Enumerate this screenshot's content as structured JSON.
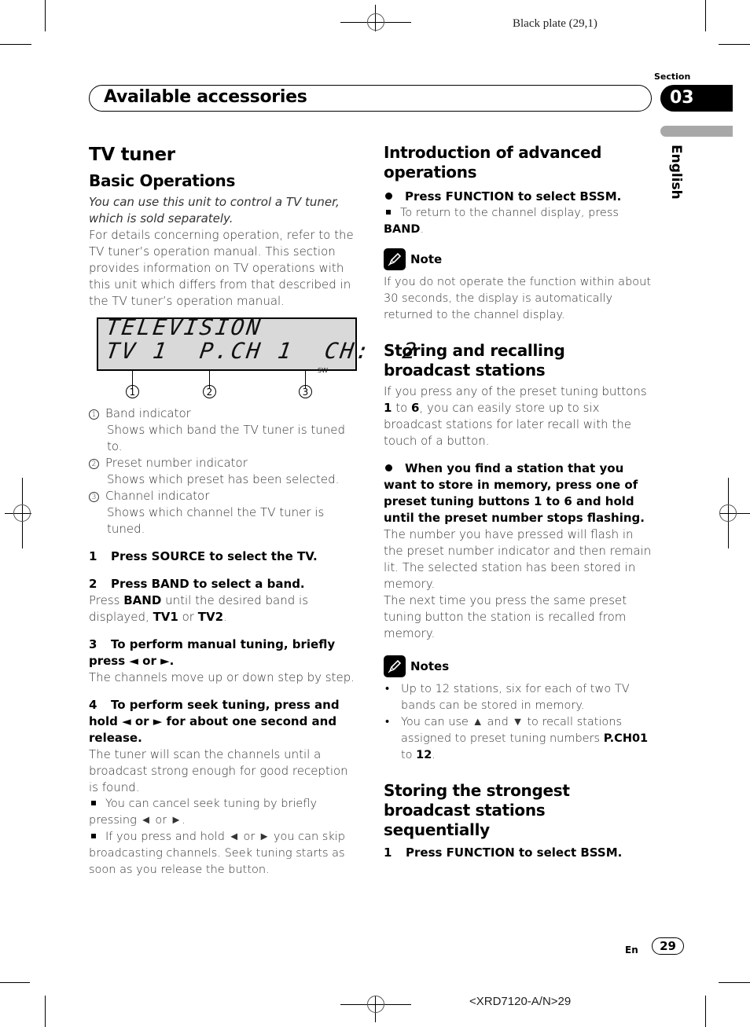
{
  "print_marks": {
    "plate_label": "Black plate (29,1)",
    "job_code": "<XRD7120-A/N>29"
  },
  "header": {
    "banner_title": "Available accessories",
    "section_label": "Section",
    "section_number": "03",
    "language": "English"
  },
  "left": {
    "title": "TV tuner",
    "subtitle": "Basic Operations",
    "intro_italic": "You can use this unit to control a TV tuner, which is sold separately.",
    "intro": "For details concerning operation, refer to the TV tuner’s operation manual. This section provides information on TV operations with this unit which differs from that described in the TV tuner’s operation manual.",
    "lcd": {
      "line1": "TELEVISION",
      "band": "TV 1",
      "preset": "P.CH 1",
      "channel": "CH:  2",
      "sw": "SW",
      "callouts": [
        "1",
        "2",
        "3"
      ]
    },
    "indicators": [
      {
        "num": "1",
        "name": "Band indicator",
        "desc": "Shows which band the TV tuner is tuned to."
      },
      {
        "num": "2",
        "name": "Preset number indicator",
        "desc": "Shows which preset has been selected."
      },
      {
        "num": "3",
        "name": "Channel indicator",
        "desc": "Shows which channel the TV tuner is tuned."
      }
    ],
    "steps": [
      {
        "num": "1",
        "text": "Press SOURCE to select the TV."
      },
      {
        "num": "2",
        "text": "Press BAND to select a band."
      },
      {
        "num": "3",
        "text": "To perform manual tuning, briefly press ◄ or ►."
      },
      {
        "num": "4",
        "text": "To perform seek tuning, press and hold ◄ or ► for about one second and release."
      }
    ],
    "step2_body": {
      "pre": "Press ",
      "b1": "BAND",
      "mid": " until the desired band is displayed, ",
      "b2": "TV1",
      "or": " or ",
      "b3": "TV2",
      "end": "."
    },
    "step3_body": "The channels move up or down step by step.",
    "step4_body": "The tuner will scan the channels until a broadcast strong enough for good reception is found.",
    "step4_bullets": [
      "You can cancel seek tuning by briefly pressing ◄ or ►.",
      "If you press and hold ◄ or ► you can skip broadcasting channels. Seek tuning starts as soon as you release the button."
    ]
  },
  "right": {
    "adv_title": "Introduction of advanced operations",
    "adv_step": "Press FUNCTION to select BSSM.",
    "adv_bullet": {
      "pre": "To return to the channel display, press ",
      "b": "BAND",
      "end": "."
    },
    "note_label": "Note",
    "note_text": "If you do not operate the function within about 30 seconds, the display is automatically returned to the channel display.",
    "store_title": "Storing and recalling broadcast stations",
    "store_body": {
      "pre": "If you press any of the preset tuning buttons ",
      "b1": "1",
      "mid": " to ",
      "b2": "6",
      "end": ", you can easily store up to six broadcast stations for later recall with the touch of a button."
    },
    "store_step": "When you find a station that you want to store in memory, press one of preset tuning buttons 1 to 6 and hold until the preset number stops flashing.",
    "store_p1": "The number you have pressed will flash in the preset number indicator and then remain lit. The selected station has been stored in memory.",
    "store_p2": "The next time you press the same preset tuning button the station is recalled from memory.",
    "notes_label": "Notes",
    "notes": [
      {
        "text": "Up to 12 stations, six for each of two TV bands can be stored in memory."
      },
      {
        "pre": "You can use ▲ and ▼ to recall stations assigned to preset tuning numbers ",
        "b1": "P.CH01",
        "mid": " to ",
        "b2": "12",
        "end": "."
      }
    ],
    "bssm_title": "Storing the strongest broadcast stations sequentially",
    "bssm_step": {
      "num": "1",
      "text": "Press FUNCTION to select BSSM."
    }
  },
  "footer": {
    "lang_code": "En",
    "page_number": "29"
  }
}
